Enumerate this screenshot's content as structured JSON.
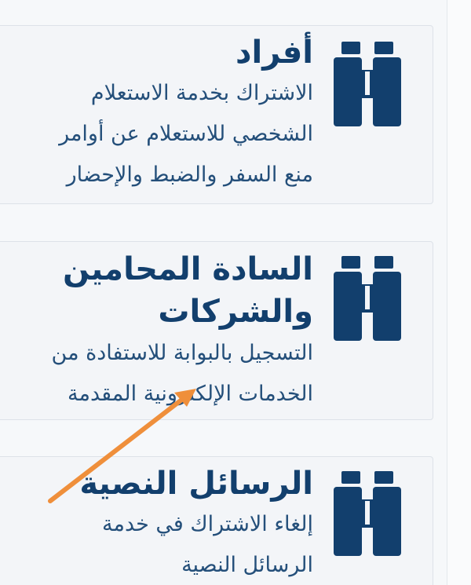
{
  "cards": [
    {
      "title": "أفراد",
      "desc_lines": [
        "الاشتراك بخدمة الاستعلام",
        "الشخصي للاستعلام عن أوامر",
        "منع السفر والضبط والإحضار"
      ],
      "icon": "binoculars-icon"
    },
    {
      "title_lines": [
        "السادة المحامين",
        "والشركات"
      ],
      "desc_lines": [
        "التسجيل بالبوابة للاستفادة من",
        "الخدمات الإلكترونية المقدمة"
      ],
      "icon": "binoculars-icon"
    },
    {
      "title": "الرسائل النصية",
      "desc_lines": [
        "إلغاء الاشتراك في خدمة",
        "الرسائل النصية"
      ],
      "icon": "binoculars-icon"
    }
  ],
  "colors": {
    "icon": "#123f6d",
    "title": "#123f6d",
    "text": "#244f7a",
    "arrow": "#ef8f3b",
    "card_bg": "#f3f5f8",
    "card_border": "#dde2e8"
  }
}
